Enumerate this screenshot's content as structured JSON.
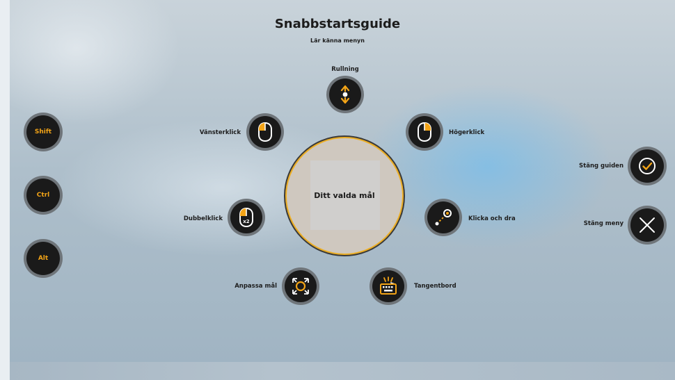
{
  "header": {
    "title": "Snabbstartsguide",
    "subtitle": "Lär känna menyn"
  },
  "modifiers": {
    "shift": "Shift",
    "ctrl": "Ctrl",
    "alt": "Alt"
  },
  "actions": {
    "scroll": "Rullning",
    "left_click": "Vänsterklick",
    "right_click": "Högerklick",
    "double_click": "Dubbelklick",
    "drag": "Klicka och dra",
    "adjust_target": "Anpassa mål",
    "keyboard": "Tangentbord"
  },
  "center": {
    "label": "Ditt valda mål"
  },
  "side_actions": {
    "close_guide": "Stäng guiden",
    "close_menu": "Stäng meny"
  },
  "icons": {
    "double_click_badge": "x2"
  },
  "colors": {
    "accent": "#f3a417",
    "button_bg": "#1a1a1a",
    "button_ring": "#6f757a"
  }
}
